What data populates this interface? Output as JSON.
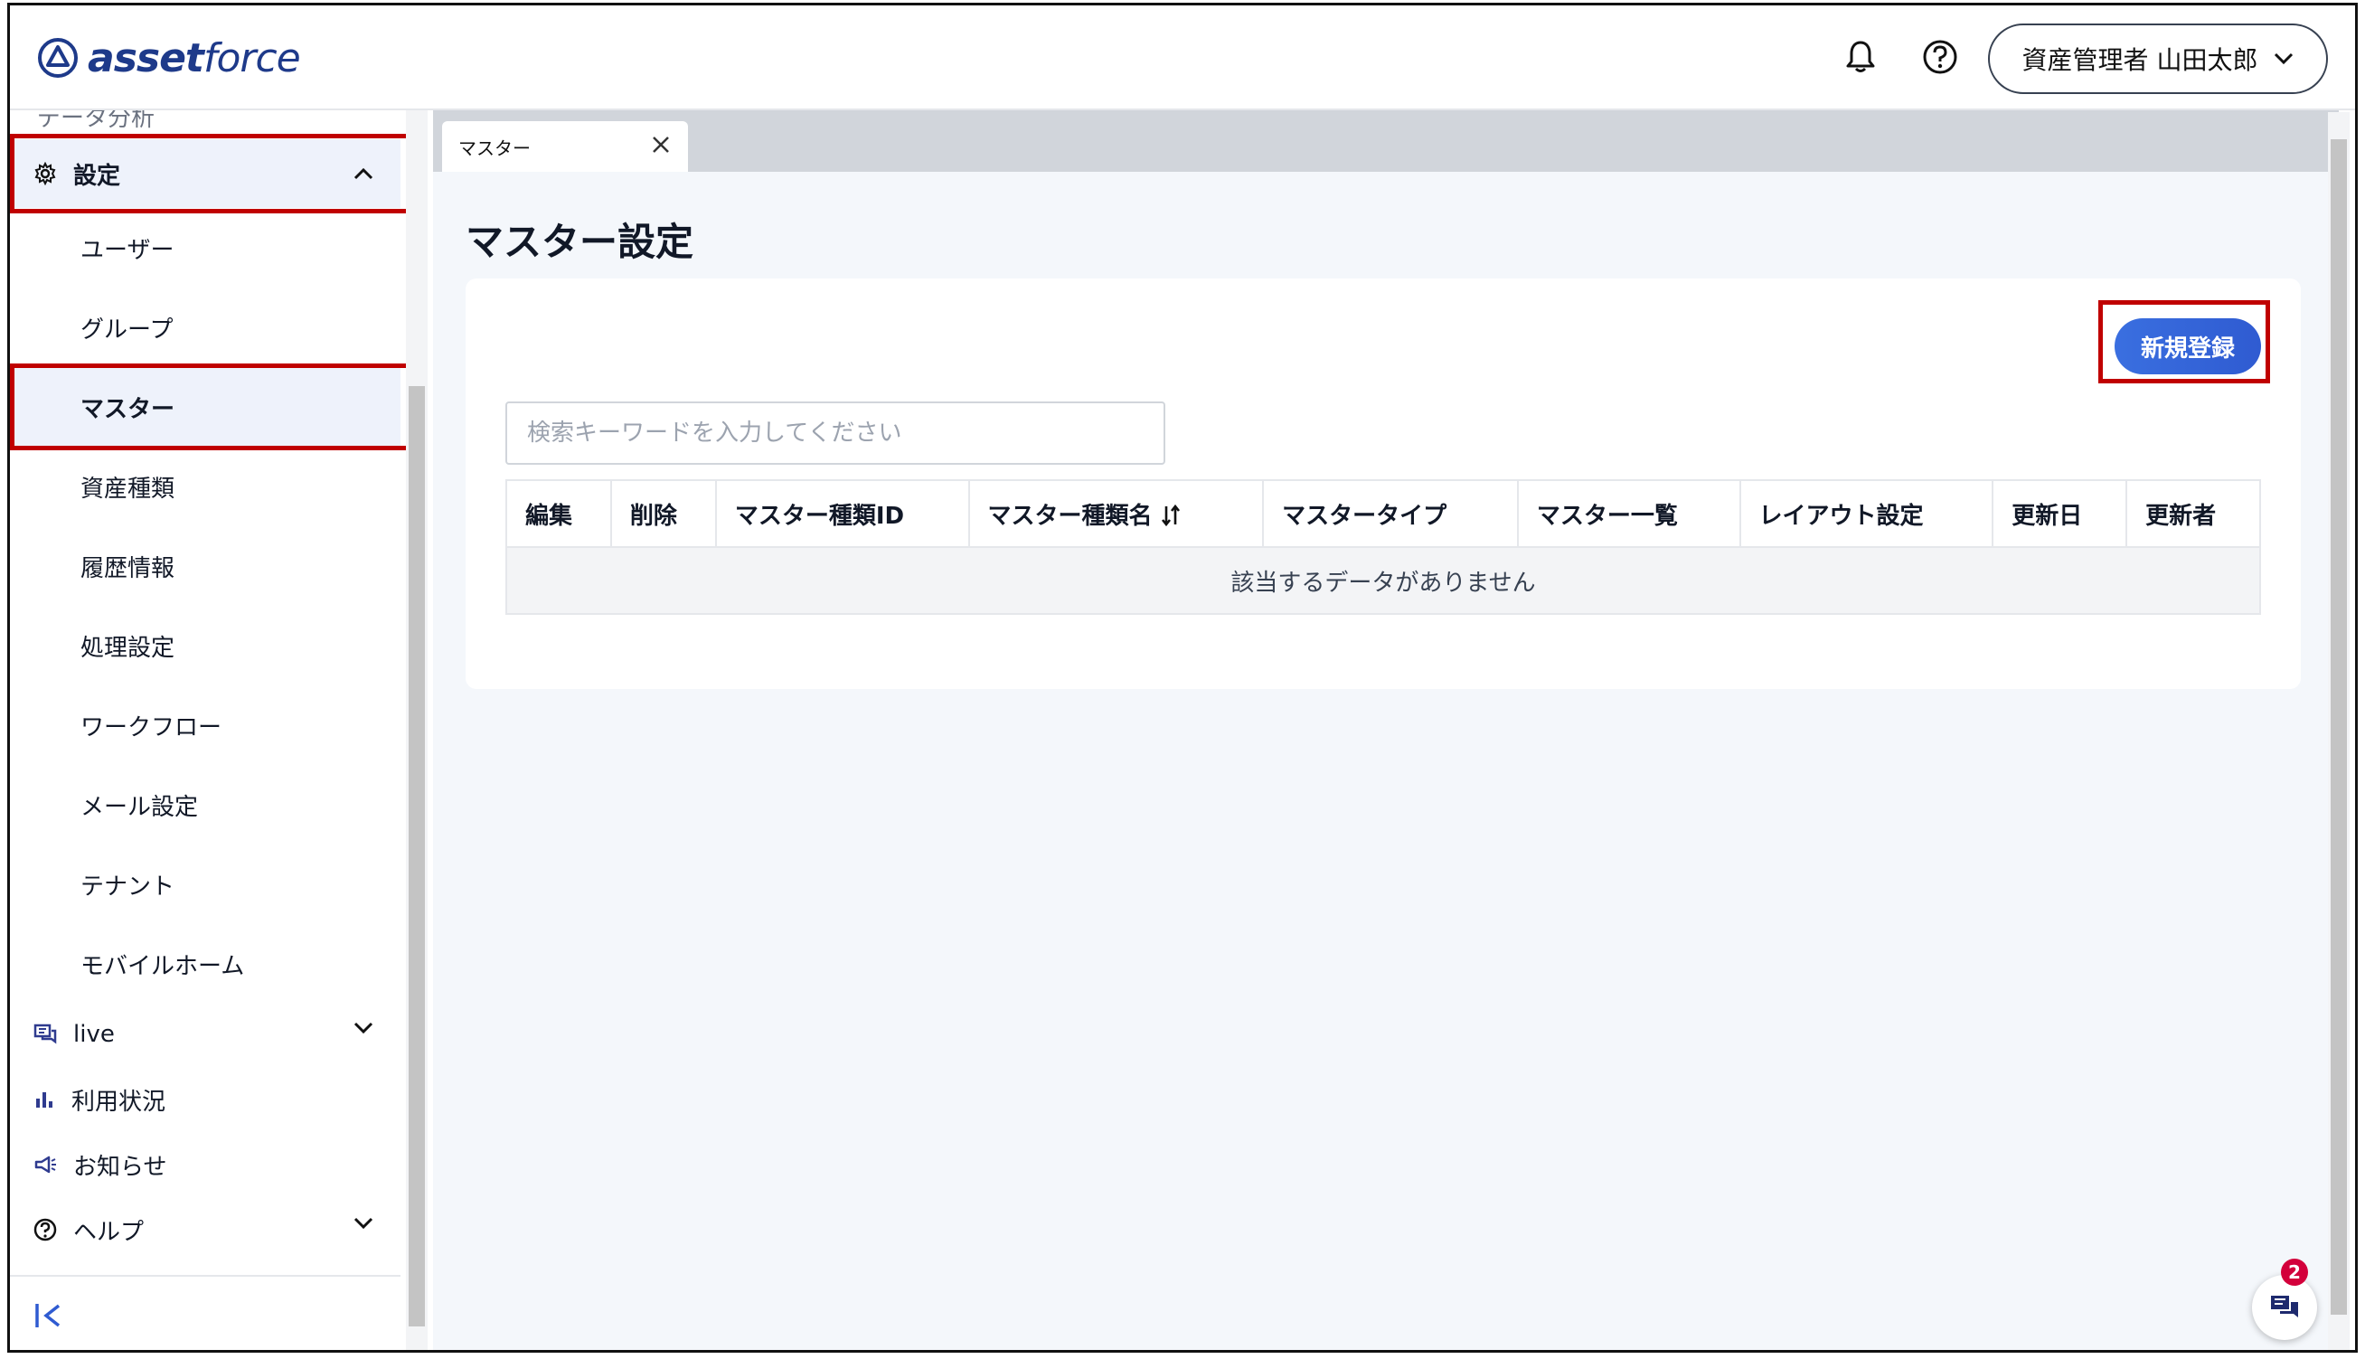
{
  "header": {
    "logo_asset": "asset",
    "logo_force": "force",
    "user_label": "資産管理者 山田太郎"
  },
  "sidebar": {
    "partial_item": "データ分析",
    "settings": {
      "label": "設定"
    },
    "sub_items": [
      {
        "label": "ユーザー"
      },
      {
        "label": "グループ"
      },
      {
        "label": "マスター"
      },
      {
        "label": "資産種類"
      },
      {
        "label": "履歴情報"
      },
      {
        "label": "処理設定"
      },
      {
        "label": "ワークフロー"
      },
      {
        "label": "メール設定"
      },
      {
        "label": "テナント"
      },
      {
        "label": "モバイルホーム"
      }
    ],
    "bottom_items": [
      {
        "label": "live"
      },
      {
        "label": "利用状況"
      },
      {
        "label": "お知らせ"
      },
      {
        "label": "ヘルプ"
      }
    ]
  },
  "tabs": [
    {
      "label": "マスター"
    }
  ],
  "page": {
    "title": "マスター設定",
    "new_button": "新規登録",
    "search_placeholder": "検索キーワードを入力してください"
  },
  "table": {
    "columns": [
      "編集",
      "削除",
      "マスター種類ID",
      "マスター種類名",
      "マスタータイプ",
      "マスター一覧",
      "レイアウト設定",
      "更新日",
      "更新者"
    ],
    "empty_message": "該当するデータがありません"
  },
  "chat": {
    "badge_count": "2"
  },
  "colors": {
    "accent": "#2f5bd1",
    "highlight_box": "#c00000",
    "badge": "#d3003b"
  }
}
